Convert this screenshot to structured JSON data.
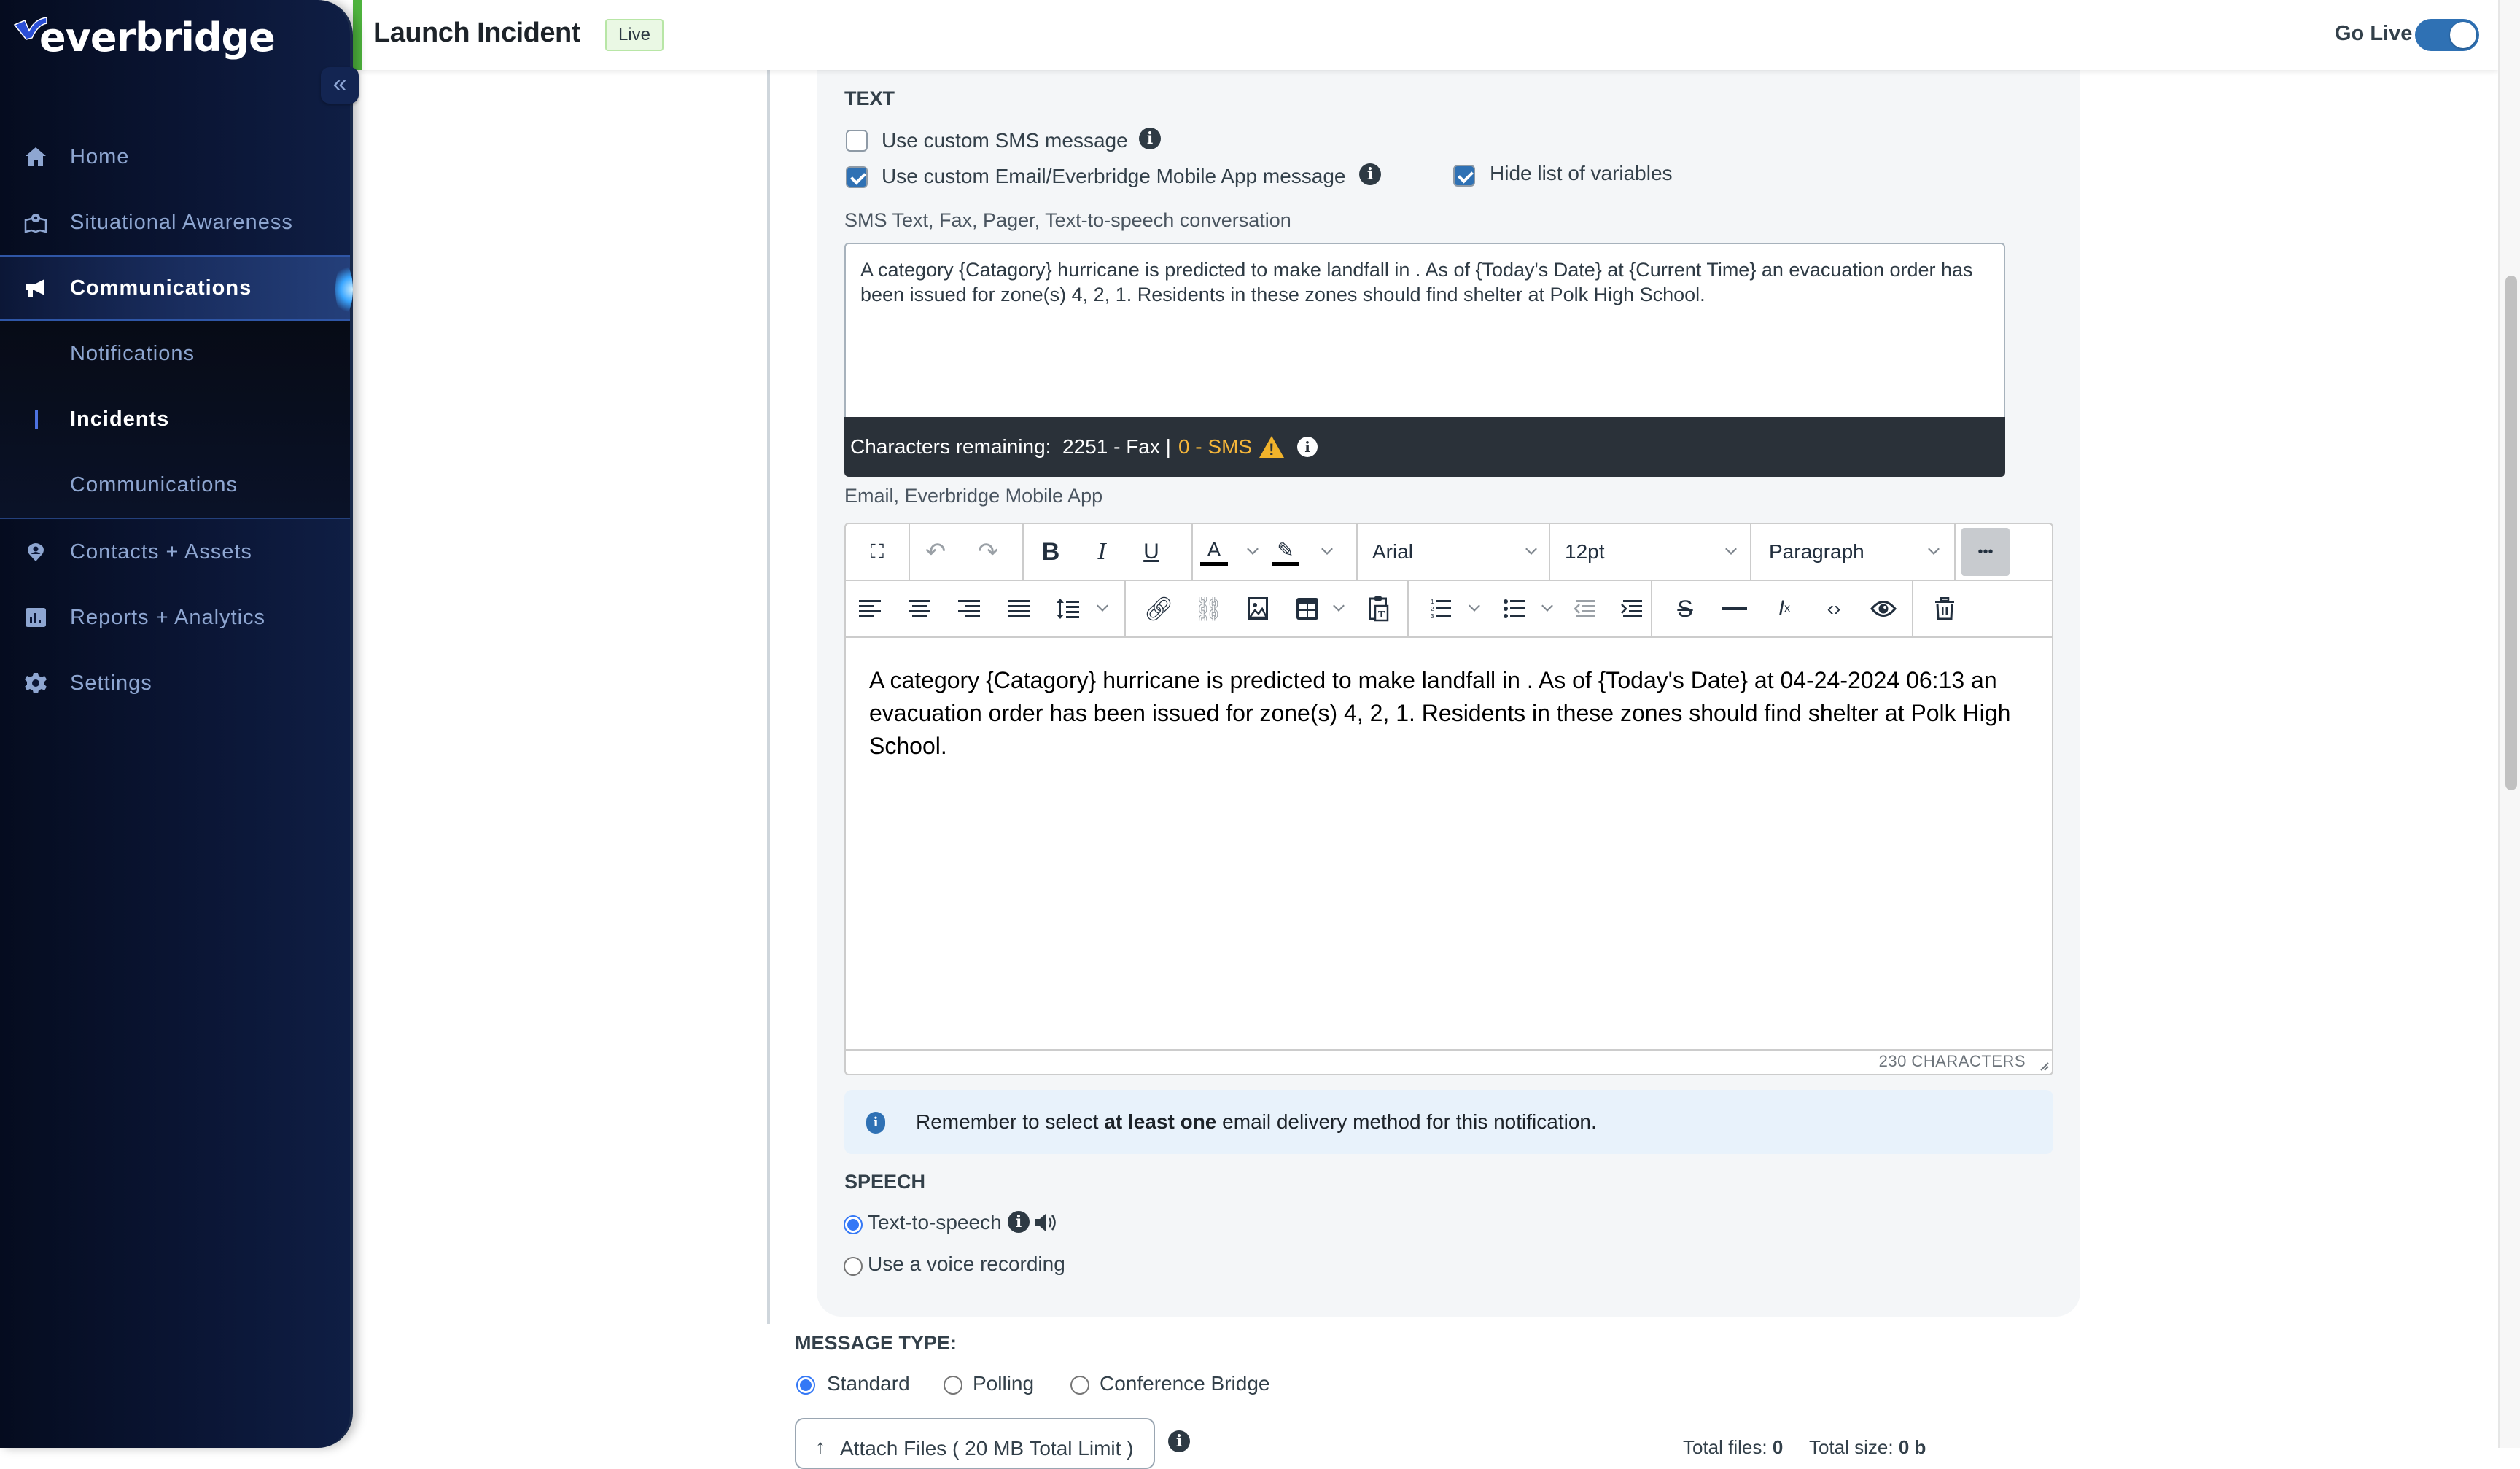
{
  "brand": {
    "name": "everbridge",
    "trademark": "™"
  },
  "sidebar": {
    "collapse_label": "«",
    "items": [
      {
        "label": "Home",
        "icon": "home-icon"
      },
      {
        "label": "Situational Awareness",
        "icon": "map-pin-icon"
      },
      {
        "label": "Communications",
        "icon": "megaphone-icon",
        "active": true
      },
      {
        "label": "Contacts + Assets",
        "icon": "location-person-icon"
      },
      {
        "label": "Reports + Analytics",
        "icon": "bar-chart-icon"
      },
      {
        "label": "Settings",
        "icon": "gear-icon"
      }
    ],
    "subitems": [
      {
        "label": "Notifications"
      },
      {
        "label": "Incidents",
        "active": true
      },
      {
        "label": "Communications"
      }
    ]
  },
  "header": {
    "title": "Launch Incident",
    "badge": "Live",
    "go_live_label": "Go Live",
    "go_live_on": true
  },
  "text_section": {
    "title": "TEXT",
    "custom_sms": {
      "label": "Use custom SMS message",
      "checked": false
    },
    "custom_email": {
      "label": "Use custom Email/Everbridge Mobile App message",
      "checked": true
    },
    "hide_variables": {
      "label": "Hide list of variables",
      "checked": true
    },
    "sms_field_label": "SMS Text, Fax, Pager, Text-to-speech conversation",
    "sms_text": "A category {Catagory} hurricane is predicted to make landfall in . As of {Today's Date} at {Current Time} an evacuation order has been issued for zone(s) 4, 2, 1. Residents in these zones should find shelter at Polk High School.",
    "chars_remaining_label": "Characters remaining:",
    "chars_fax": "2251 - Fax",
    "chars_sep": "|",
    "chars_sms": "0 - SMS",
    "email_field_label": "Email, Everbridge Mobile App"
  },
  "editor": {
    "font_family": "Arial",
    "font_size": "12pt",
    "block_format": "Paragraph",
    "content": "A category {Catagory} hurricane is predicted to make landfall in . As of {Today's Date} at 04-24-2024 06:13 an evacuation order has been issued for zone(s) 4, 2, 1. Residents in these zones should find shelter at Polk High School.",
    "char_count": "230 CHARACTERS",
    "more_label": "•••"
  },
  "info_box": {
    "prefix": "Remember to select ",
    "bold": "at least one",
    "suffix": " email delivery method for this notification."
  },
  "speech": {
    "title": "SPEECH",
    "options": [
      {
        "label": "Text-to-speech",
        "selected": true
      },
      {
        "label": "Use a voice recording",
        "selected": false
      }
    ]
  },
  "message_type": {
    "title": "MESSAGE TYPE:",
    "options": [
      {
        "label": "Standard",
        "selected": true
      },
      {
        "label": "Polling",
        "selected": false
      },
      {
        "label": "Conference Bridge",
        "selected": false
      }
    ]
  },
  "attachments": {
    "button_label": "Attach Files ( 20 MB Total Limit )",
    "total_files_label": "Total files:",
    "total_files": "0",
    "total_size_label": "Total size:",
    "total_size": "0 b"
  },
  "colors": {
    "sidebar_bg": "#0b1636",
    "accent_blue": "#2f71b4",
    "live_green": "#4eb33d",
    "sms_warning": "#f5b63a",
    "radio_blue": "#3478f6"
  }
}
